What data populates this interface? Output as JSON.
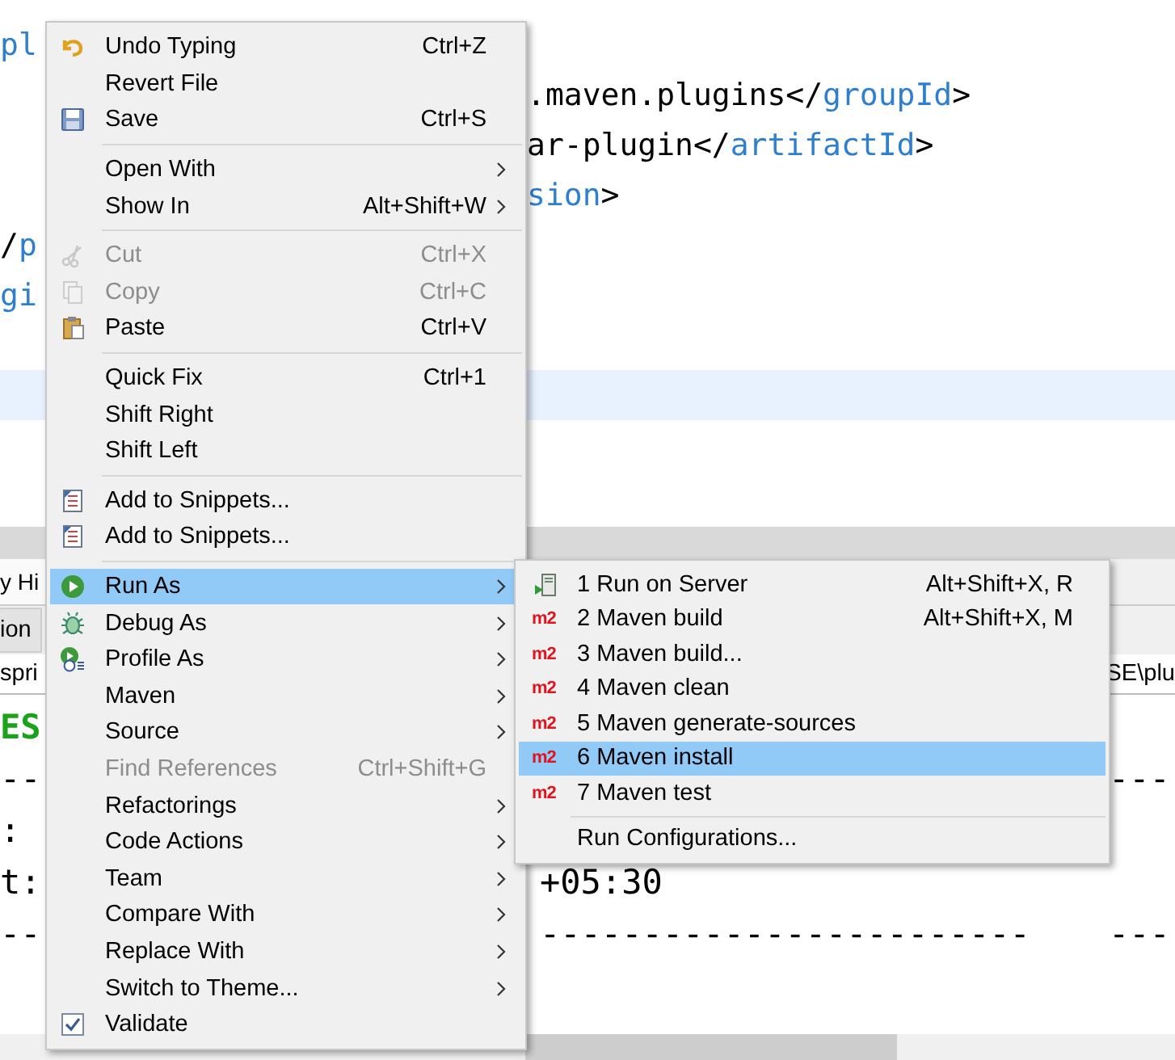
{
  "editor": {
    "lines": [
      {
        "current": false,
        "left": [
          {
            "text": "pl",
            "kind": "tag"
          }
        ]
      },
      {
        "current": false,
        "right": [
          {
            "text": ".maven.plugins</",
            "kind": "plain"
          },
          {
            "text": "groupId",
            "kind": "tag"
          },
          {
            "text": ">",
            "kind": "plain"
          }
        ]
      },
      {
        "current": false,
        "right": [
          {
            "text": "ar-plugin</",
            "kind": "plain"
          },
          {
            "text": "artifactId",
            "kind": "tag"
          },
          {
            "text": ">",
            "kind": "plain"
          }
        ]
      },
      {
        "current": false,
        "right": [
          {
            "text": "sion",
            "kind": "tag"
          },
          {
            "text": ">",
            "kind": "plain"
          }
        ]
      },
      {
        "current": false,
        "left": [
          {
            "text": "/",
            "kind": "plain"
          },
          {
            "text": "p",
            "kind": "tag"
          }
        ]
      },
      {
        "current": false,
        "left": [
          {
            "text": "gi",
            "kind": "tag"
          }
        ]
      },
      {
        "current": false
      },
      {
        "current": true
      }
    ]
  },
  "console": {
    "tab": "y Hi",
    "toolbar_button": "ion",
    "path_left": "spri",
    "path_right": "SE\\plu",
    "lines": [
      {
        "kind": "success",
        "left": "ES"
      },
      {
        "kind": "plain",
        "left": "--",
        "far": "---"
      },
      {
        "kind": "plain",
        "left": ":"
      },
      {
        "kind": "plain",
        "left": "t:",
        "middle": "+05:30"
      },
      {
        "kind": "plain",
        "left": "--",
        "middle": "------------------------",
        "far": "---"
      }
    ]
  },
  "context_menu": {
    "items": [
      {
        "kind": "item",
        "label": "Undo Typing",
        "shortcut": "Ctrl+Z",
        "submenu": false,
        "disabled": false,
        "selected": false
      },
      {
        "kind": "item",
        "label": "Revert File",
        "submenu": false,
        "disabled": false,
        "selected": false
      },
      {
        "kind": "item",
        "label": "Save",
        "shortcut": "Ctrl+S",
        "submenu": false,
        "disabled": false,
        "selected": false
      },
      {
        "kind": "separator"
      },
      {
        "kind": "item",
        "label": "Open With",
        "submenu": true,
        "disabled": false,
        "selected": false
      },
      {
        "kind": "item",
        "label": "Show In",
        "shortcut": "Alt+Shift+W",
        "submenu": true,
        "disabled": false,
        "selected": false
      },
      {
        "kind": "separator"
      },
      {
        "kind": "item",
        "label": "Cut",
        "shortcut": "Ctrl+X",
        "submenu": false,
        "disabled": true,
        "selected": false
      },
      {
        "kind": "item",
        "label": "Copy",
        "shortcut": "Ctrl+C",
        "submenu": false,
        "disabled": true,
        "selected": false
      },
      {
        "kind": "item",
        "label": "Paste",
        "shortcut": "Ctrl+V",
        "submenu": false,
        "disabled": false,
        "selected": false
      },
      {
        "kind": "separator"
      },
      {
        "kind": "item",
        "label": "Quick Fix",
        "shortcut": "Ctrl+1",
        "submenu": false,
        "disabled": false,
        "selected": false
      },
      {
        "kind": "item",
        "label": "Shift Right",
        "submenu": false,
        "disabled": false,
        "selected": false
      },
      {
        "kind": "item",
        "label": "Shift Left",
        "submenu": false,
        "disabled": false,
        "selected": false
      },
      {
        "kind": "separator"
      },
      {
        "kind": "item",
        "label": "Add to Snippets...",
        "submenu": false,
        "disabled": false,
        "selected": false
      },
      {
        "kind": "item",
        "label": "Add to Snippets...",
        "submenu": false,
        "disabled": false,
        "selected": false
      },
      {
        "kind": "separator"
      },
      {
        "kind": "item",
        "label": "Run As",
        "submenu": true,
        "disabled": false,
        "selected": true
      },
      {
        "kind": "item",
        "label": "Debug As",
        "submenu": true,
        "disabled": false,
        "selected": false
      },
      {
        "kind": "item",
        "label": "Profile As",
        "submenu": true,
        "disabled": false,
        "selected": false
      },
      {
        "kind": "item",
        "label": "Maven",
        "submenu": true,
        "disabled": false,
        "selected": false
      },
      {
        "kind": "item",
        "label": "Source",
        "submenu": true,
        "disabled": false,
        "selected": false
      },
      {
        "kind": "item",
        "label": "Find References",
        "shortcut": "Ctrl+Shift+G",
        "submenu": false,
        "disabled": true,
        "selected": false
      },
      {
        "kind": "item",
        "label": "Refactorings",
        "submenu": true,
        "disabled": false,
        "selected": false
      },
      {
        "kind": "item",
        "label": "Code Actions",
        "submenu": true,
        "disabled": false,
        "selected": false
      },
      {
        "kind": "item",
        "label": "Team",
        "submenu": true,
        "disabled": false,
        "selected": false
      },
      {
        "kind": "item",
        "label": "Compare With",
        "submenu": true,
        "disabled": false,
        "selected": false
      },
      {
        "kind": "item",
        "label": "Replace With",
        "submenu": true,
        "disabled": false,
        "selected": false
      },
      {
        "kind": "item",
        "label": "Switch to Theme...",
        "submenu": true,
        "disabled": false,
        "selected": false
      },
      {
        "kind": "item",
        "label": "Validate",
        "submenu": false,
        "disabled": false,
        "selected": false
      }
    ]
  },
  "run_as_menu": {
    "items": [
      {
        "kind": "item",
        "label": "1 Run on Server",
        "shortcut": "Alt+Shift+X, R",
        "selected": false
      },
      {
        "kind": "item",
        "badge": "m2",
        "label": "2 Maven build",
        "shortcut": "Alt+Shift+X, M",
        "selected": false
      },
      {
        "kind": "item",
        "badge": "m2",
        "label": "3 Maven build...",
        "selected": false
      },
      {
        "kind": "item",
        "badge": "m2",
        "label": "4 Maven clean",
        "selected": false
      },
      {
        "kind": "item",
        "badge": "m2",
        "label": "5 Maven generate-sources",
        "selected": false
      },
      {
        "kind": "item",
        "badge": "m2",
        "label": "6 Maven install",
        "selected": true
      },
      {
        "kind": "item",
        "badge": "m2",
        "label": "7 Maven test",
        "selected": false
      },
      {
        "kind": "separator"
      },
      {
        "kind": "item",
        "label": "Run Configurations...",
        "selected": false
      }
    ]
  }
}
